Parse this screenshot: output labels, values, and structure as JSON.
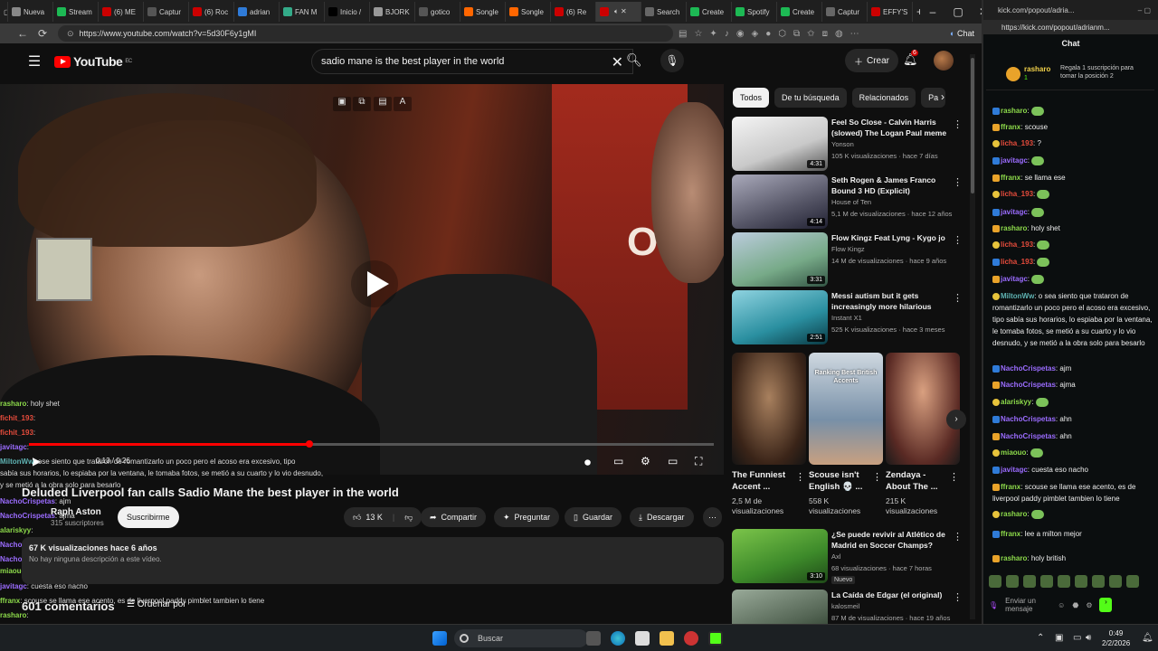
{
  "browser": {
    "tabs": [
      "Nueva",
      "Stream",
      "(6) ME",
      "Captur",
      "(6) Roc",
      "adrian",
      "FAN M",
      "Inicio /",
      "BJORK",
      "gotico",
      "Songle",
      "Songle",
      "(6) Re",
      "",
      "Search",
      "Create",
      "Spotify",
      "Create",
      "Captur",
      "EFFY'S"
    ],
    "url": "https://www.youtube.com/watch?v=5d30F6y1gMI",
    "chat_button": "Chat"
  },
  "youtube": {
    "logo": "YouTube",
    "logo_country": "EC",
    "search_value": "sadio mane is the best player in the world",
    "create_label": "Crear",
    "notif_count": "6",
    "video": {
      "time": "0:13 / 0:26",
      "progress": 0.41,
      "title": "Deluded Liverpool fan calls Sadio Mane the best player in the world",
      "channel": "Raph Aston",
      "subs": "315 suscriptores",
      "subscribe_label": "Suscribirme",
      "likes": "13 K",
      "share_label": "Compartir",
      "ask_label": "Preguntar",
      "save_label": "Guardar",
      "download_label": "Descargar",
      "views": "67 K visualizaciones  hace 6 años",
      "description": "No hay ninguna descripción a este vídeo.",
      "comments": "601 comentarios",
      "sort_label": "Ordenar por"
    },
    "chips": [
      "Todos",
      "De tu búsqueda",
      "Relacionados",
      "Pa"
    ],
    "recommendations": [
      {
        "title": "Feel So Close - Calvin Harris (slowed) The Logan Paul meme",
        "channel": "Yonson",
        "meta": "105 K visualizaciones · hace 7 días",
        "duration": "4:31"
      },
      {
        "title": "Seth Rogen & James Franco Bound 3 HD (Explicit)",
        "channel": "House of Ten",
        "meta": "5,1 M de visualizaciones · hace 12 años",
        "duration": "4:14"
      },
      {
        "title": "Flow Kingz Feat Lyng - Kygo jo",
        "channel": "Flow Kingz",
        "meta": "14 M de visualizaciones · hace 9 años",
        "duration": "3:31"
      },
      {
        "title": "Messi autism but it gets increasingly more hilarious",
        "channel": "Instant X1",
        "meta": "525 K visualizaciones · hace 3 meses",
        "duration": "2:51"
      },
      {
        "title": "¿Se puede revivir al Atlético de Madrid en Soccer Champs?",
        "channel": "Axl",
        "meta": "68 visualizaciones · hace 7 horas",
        "duration": "3:10"
      },
      {
        "title": "La Caída de Edgar (el original)",
        "channel": "kalosmeil",
        "meta": "87 M de visualizaciones · hace 19 años",
        "duration": ""
      }
    ],
    "new_badge": "Nuevo",
    "shorts": [
      {
        "title": "The Funniest Accent ...",
        "views": "2,5 M de visualizaciones"
      },
      {
        "title": "Scouse isn't English 💀 ...",
        "views": "558 K visualizaciones"
      },
      {
        "title": "Zendaya - About The ...",
        "views": "215 K visualizaciones"
      }
    ],
    "short_overlay": "Ranking Best British Accents"
  },
  "overlay_chat": [
    {
      "user": "rasharo",
      "text": "holy shet"
    },
    {
      "user": "fichit_193",
      "text": ""
    },
    {
      "user": "fichit_193",
      "text": ""
    },
    {
      "user": "javitagc",
      "text": ""
    },
    {
      "user": "MiltonWw",
      "text": "ose siento que trataron de romantizarlo un poco pero el acoso era excesivo, tipo"
    },
    {
      "user": "",
      "text": "sabía sus horarios, lo espiaba por la ventana, le tomaba fotos, se metió a su cuarto y lo vio desnudo,"
    },
    {
      "user": "",
      "text": "y se metió a la obra solo para besarlo"
    },
    {
      "user": "NachoCrispetas",
      "text": "ajm"
    },
    {
      "user": "NachoCrispetas",
      "text": "ajma"
    },
    {
      "user": "alariskyy",
      "text": ""
    },
    {
      "user": "NachoCrispetas",
      "text": "ahn"
    },
    {
      "user": "NachoCrispetas",
      "text": "ahn"
    },
    {
      "user": "miaouo",
      "text": ""
    },
    {
      "user": "javitagc",
      "text": "cuesta eso nacho"
    },
    {
      "user": "ffranx",
      "text": "scouse se llama ese acento, es de liverpool paddy pimblet tambien lo tiene"
    },
    {
      "user": "rasharo",
      "text": ""
    },
    {
      "user": "NachoCrispetas",
      "text": "lee a milton mejor"
    },
    {
      "user": "rasharo",
      "text": "holy british"
    }
  ],
  "kick": {
    "tab_title": "kick.com/popout/adria...",
    "url": "https://kick.com/popout/adrianm...",
    "header": "Chat",
    "pinned_user": "rasharo",
    "pinned_count": "1",
    "pinned_text": "Regala 1 suscripción para tomar la posición 2",
    "messages": [
      {
        "user": "rasharo",
        "text": "",
        "color": "#8cd94a"
      },
      {
        "user": "ffranx",
        "text": "scouse",
        "color": "#8cd94a"
      },
      {
        "user": "licha_193",
        "text": "?",
        "color": "#e74c3c"
      },
      {
        "user": "javitagc",
        "text": "",
        "color": "#9b6cff"
      },
      {
        "user": "ffranx",
        "text": "se llama ese",
        "color": "#8cd94a"
      },
      {
        "user": "licha_193",
        "text": "",
        "color": "#e74c3c"
      },
      {
        "user": "javitagc",
        "text": "",
        "color": "#9b6cff"
      },
      {
        "user": "rasharo",
        "text": "holy shet",
        "color": "#8cd94a"
      },
      {
        "user": "licha_193",
        "text": "",
        "color": "#e74c3c"
      },
      {
        "user": "licha_193",
        "text": "",
        "color": "#e74c3c"
      },
      {
        "user": "javitagc",
        "text": "",
        "color": "#9b6cff"
      },
      {
        "user": "MiltonWw",
        "text": "o sea siento que trataron de romantizarlo un poco pero el acoso era excesivo, tipo sabía sus horarios, lo espiaba por la ventana, le tomaba fotos, se metió a su cuarto y lo vio desnudo, y se metió a la obra solo para besarlo",
        "color": "#5fb3b3"
      },
      {
        "user": "NachoCrispetas",
        "text": "ajm",
        "color": "#9b6cff"
      },
      {
        "user": "NachoCrispetas",
        "text": "ajma",
        "color": "#9b6cff"
      },
      {
        "user": "alariskyy",
        "text": "",
        "color": "#8cd94a"
      },
      {
        "user": "NachoCrispetas",
        "text": "ahn",
        "color": "#9b6cff"
      },
      {
        "user": "NachoCrispetas",
        "text": "ahn",
        "color": "#9b6cff"
      },
      {
        "user": "miaouo",
        "text": "",
        "color": "#8cd94a"
      },
      {
        "user": "javitagc",
        "text": "cuesta eso nacho",
        "color": "#9b6cff"
      },
      {
        "user": "ffranx",
        "text": "scouse se llama ese acento, es de liverpool paddy pimblet tambien lo tiene",
        "color": "#8cd94a"
      },
      {
        "user": "rasharo",
        "text": "",
        "color": "#8cd94a"
      },
      {
        "user": "ffranx",
        "text": "lee a milton mejor",
        "color": "#8cd94a"
      },
      {
        "user": "rasharo",
        "text": "holy british",
        "color": "#8cd94a"
      }
    ],
    "input_placeholder": "Enviar un mensaje"
  },
  "taskbar": {
    "search_label": "Buscar",
    "time": "0:49",
    "date": "2/2/2026"
  }
}
